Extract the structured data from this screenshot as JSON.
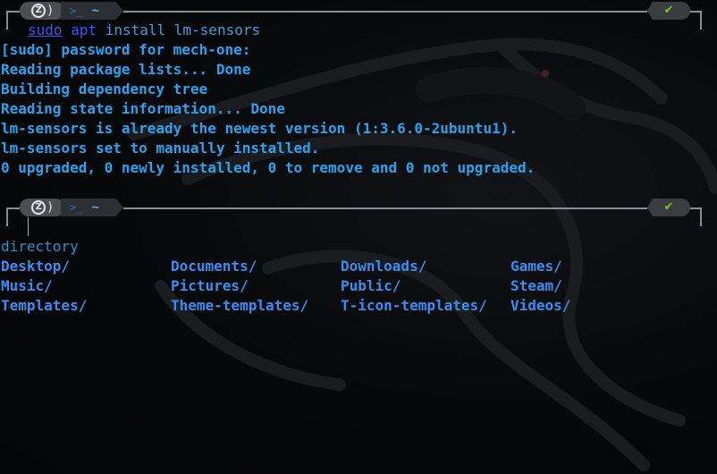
{
  "theme": {
    "accent": "#2ba3ec",
    "dir_color": "#3a8ef0",
    "cmd_color": "#3a55f0",
    "status_ok": "#7cc33a"
  },
  "prompt1": {
    "logo_icon": "zorin-logo-icon",
    "terminal_icon": "terminal-icon",
    "path": "~",
    "status_icon": "check-icon",
    "status_glyph": "✔"
  },
  "command": {
    "sudo": "sudo",
    "apt": "apt",
    "rest": " install lm-sensors"
  },
  "output": [
    "[sudo] password for mech-one:",
    "Reading package lists... Done",
    "Building dependency tree",
    "Reading state information... Done",
    "lm-sensors is already the newest version (1:3.6.0-2ubuntu1).",
    "lm-sensors set to manually installed.",
    "0 upgraded, 0 newly installed, 0 to remove and 0 not upgraded."
  ],
  "prompt2": {
    "logo_icon": "zorin-logo-icon",
    "terminal_icon": "terminal-icon",
    "path": "~",
    "status_icon": "check-icon",
    "status_glyph": "✔"
  },
  "completion": {
    "label": "directory",
    "rows": [
      [
        "Desktop/",
        "Documents/",
        "Downloads/",
        "Games/"
      ],
      [
        "Music/",
        "Pictures/",
        "Public/",
        "Steam/"
      ],
      [
        "Templates/",
        "Theme-templates/",
        "T-icon-templates/",
        "Videos/"
      ]
    ]
  }
}
